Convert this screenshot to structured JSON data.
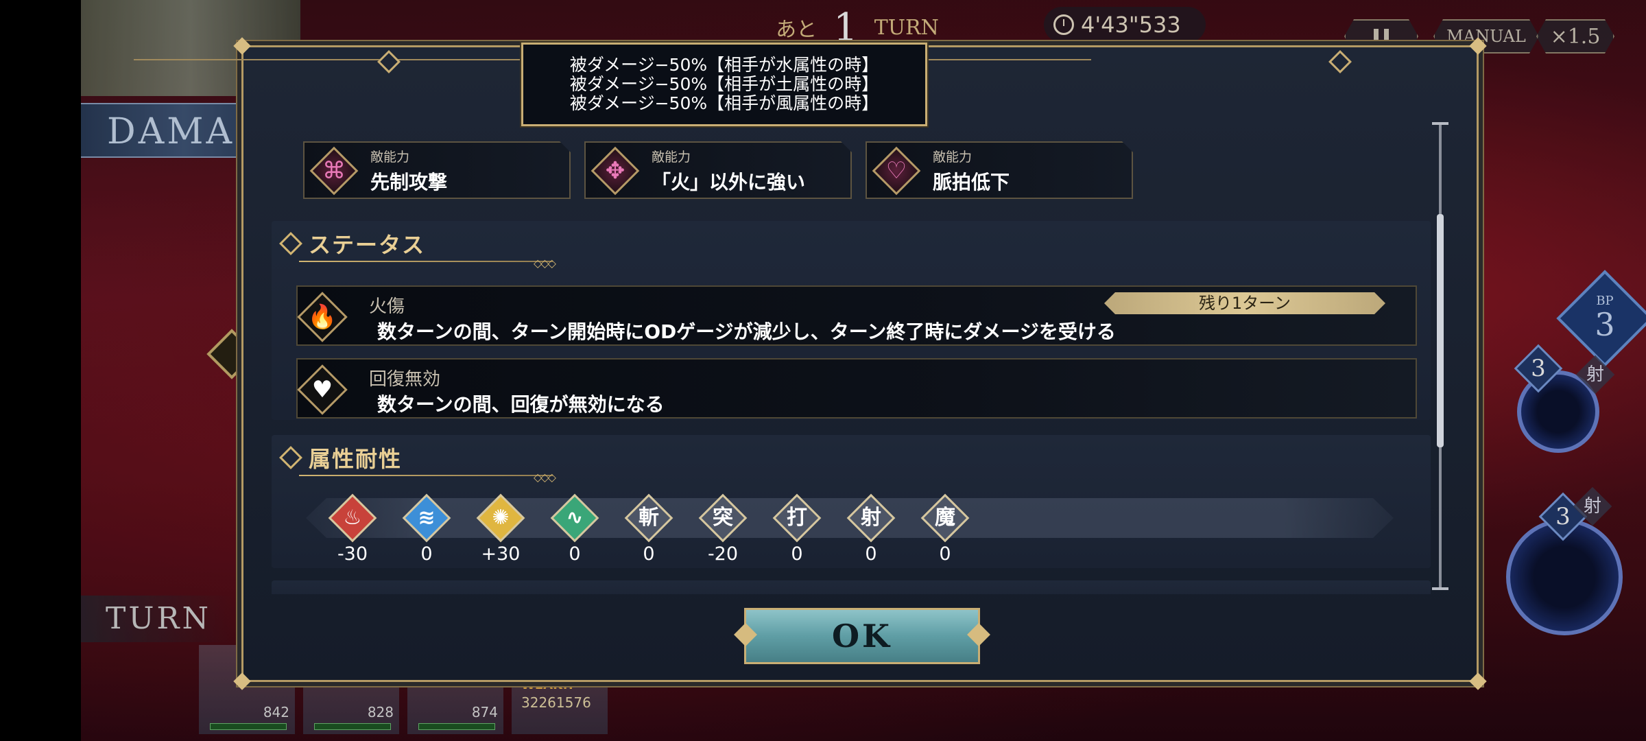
{
  "hud": {
    "damage_banner": "DAMAG",
    "turn_label": "TURN",
    "turn_prefix": "あと",
    "turn_count": "1",
    "turn_suffix": "TURN",
    "timer": "4'43\"533",
    "manual_label": "MANUAL",
    "speed_label": "×1.5",
    "bp_label": "BP",
    "bp_value": "3",
    "orb1_count": "3",
    "orb1_kind": "射",
    "orb2_count": "3",
    "orb2_kind": "射"
  },
  "party": [
    {
      "hp": "842"
    },
    {
      "hp": "828"
    },
    {
      "hp": "874"
    },
    {
      "weak": "WEAK!!",
      "damage": "32261576"
    }
  ],
  "tooltip": {
    "lines": [
      "被ダメージ−50%【相手が水属性の時】",
      "被ダメージ−50%【相手が土属性の時】",
      "被ダメージ−50%【相手が風属性の時】"
    ]
  },
  "abilities": [
    {
      "kind": "敵能力",
      "name": "先制攻撃",
      "icon": "knot-icon"
    },
    {
      "kind": "敵能力",
      "name": "「火」以外に強い",
      "icon": "pentagram-knot-icon"
    },
    {
      "kind": "敵能力",
      "name": "脈拍低下",
      "icon": "heart-pulse-icon"
    }
  ],
  "status_section": {
    "title": "ステータス",
    "items": [
      {
        "name": "火傷",
        "desc": "数ターンの間、ターン開始時にODゲージが減少し、ターン終了時にダメージを受ける",
        "remaining": "残り1ターン",
        "icon": "flame-icon"
      },
      {
        "name": "回復無効",
        "desc": "数ターンの間、回復が無効になる",
        "icon": "heart-cross-icon"
      }
    ]
  },
  "attr_section": {
    "title": "属性耐性",
    "items": [
      {
        "name": "fire",
        "glyph": "",
        "value": "-30",
        "color": "#c8423a"
      },
      {
        "name": "water",
        "glyph": "",
        "value": "0",
        "color": "#3d8fd8"
      },
      {
        "name": "thunder",
        "glyph": "",
        "value": "+30",
        "color": "#e0b640"
      },
      {
        "name": "wind",
        "glyph": "",
        "value": "0",
        "color": "#3aa678"
      },
      {
        "name": "slash",
        "glyph": "斬",
        "value": "0",
        "color": "#4d5566"
      },
      {
        "name": "pierce",
        "glyph": "突",
        "value": "-20",
        "color": "#4d5566"
      },
      {
        "name": "strike",
        "glyph": "打",
        "value": "0",
        "color": "#4d5566"
      },
      {
        "name": "shoot",
        "glyph": "射",
        "value": "0",
        "color": "#4d5566"
      },
      {
        "name": "magic",
        "glyph": "魔",
        "value": "0",
        "color": "#4d5566"
      }
    ]
  },
  "ok_label": "OK"
}
